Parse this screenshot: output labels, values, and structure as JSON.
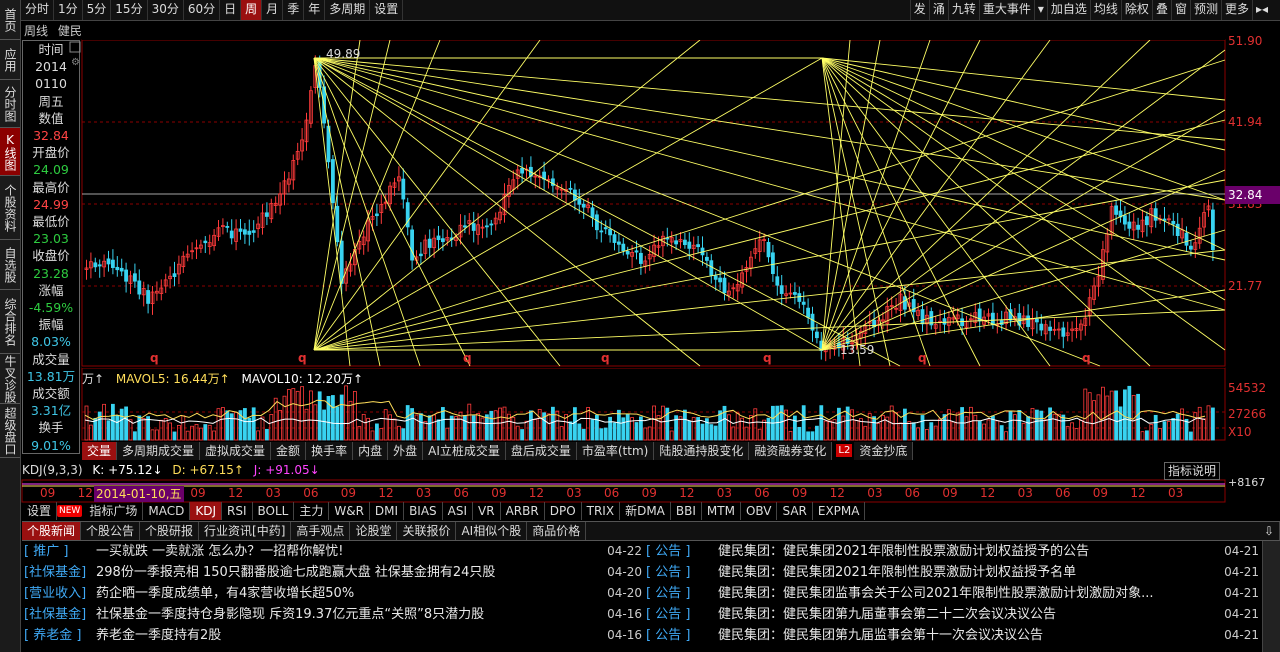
{
  "leftnav": [
    "首页",
    "应用",
    "分时图",
    "K线图",
    "个股资料",
    "自选股",
    "综合排名",
    "牛叉诊股",
    "超级盘口"
  ],
  "toolbar": {
    "periods": [
      "分时",
      "1分",
      "5分",
      "15分",
      "30分",
      "60分",
      "日",
      "周",
      "月",
      "季",
      "年",
      "多周期",
      "设置"
    ],
    "active": "周",
    "right": [
      "发",
      "涌",
      "九转",
      "重大事件",
      "▾",
      "加自选",
      "均线",
      "除权",
      "叠",
      "窗",
      "预测",
      "更多"
    ]
  },
  "subtitle": {
    "period": "周线",
    "stock": "健民集团"
  },
  "info": {
    "time_label": "时间",
    "year": "2014",
    "date": "0110",
    "weekday": "周五",
    "value_label": "数值",
    "value": "32.84",
    "open_label": "开盘价",
    "open": "24.09",
    "high_label": "最高价",
    "high": "24.99",
    "low_label": "最低价",
    "low": "23.03",
    "close_label": "收盘价",
    "close": "23.28",
    "chg_label": "涨幅",
    "chg": "-4.59%",
    "amp_label": "振幅",
    "amp": "8.03%",
    "vol_label": "成交量",
    "vol": "13.81万",
    "amt_label": "成交额",
    "amt": "3.31亿",
    "turn_label": "换手",
    "turn": "9.01%"
  },
  "price_axis": [
    "51.90",
    "41.94",
    "31.83",
    "21.77"
  ],
  "current_price": "32.84",
  "chart_labels": {
    "high": "49.89",
    "low": "13.59",
    "q": "q"
  },
  "vol": {
    "prefix": "万↑",
    "mavol5": "MAVOL5: 16.44万↑",
    "mavol10": "MAVOL10: 12.20万↑",
    "axis": [
      "54532",
      "27266",
      "X10"
    ]
  },
  "indtabs": [
    "交量",
    "多周期成交量",
    "虚拟成交量",
    "金额",
    "换手率",
    "内盘",
    "外盘",
    "AI立桩成交量",
    "盘后成交量",
    "市盈率(ttm)",
    "陆股通持股变化",
    "融资融券变化",
    "资金抄底"
  ],
  "indtabs_badge": "L2",
  "kdj": {
    "name": "KDJ(9,3,3)",
    "k": "K: +75.12↓",
    "d": "D: +67.15↑",
    "j": "J: +91.05↓",
    "button": "指标说明",
    "axis": "+8167"
  },
  "dateaxis": [
    "09",
    "12",
    "03",
    "06",
    "09",
    "12",
    "03",
    "06",
    "09",
    "12",
    "03",
    "06",
    "09",
    "12",
    "03",
    "06",
    "09",
    "12",
    "03",
    "06",
    "09",
    "12",
    "03",
    "06",
    "09",
    "12",
    "03",
    "06",
    "09",
    "12",
    "03"
  ],
  "dateflag": "2014-01-10,五",
  "bottabs": {
    "settings": "设置",
    "new": "NEW",
    "items": [
      "指标广场",
      "MACD",
      "KDJ",
      "RSI",
      "BOLL",
      "主力",
      "W&R",
      "DMI",
      "BIAS",
      "ASI",
      "VR",
      "ARBR",
      "DPO",
      "TRIX",
      "新DMA",
      "BBI",
      "MTM",
      "OBV",
      "SAR",
      "EXPMA"
    ],
    "active": "KDJ"
  },
  "newstabs": {
    "items": [
      "个股新闻",
      "个股公告",
      "个股研报",
      "行业资讯[中药]",
      "高手观点",
      "论股堂",
      "关联报价",
      "AI相似个股",
      "商品价格"
    ],
    "active": "个股新闻"
  },
  "news_left": [
    {
      "tag": "[ 推广 ]",
      "title": "一买就跌 一卖就涨 怎么办？一招帮你解忧!",
      "date": "04-22"
    },
    {
      "tag": "[社保基金]",
      "title": "298份一季报亮相 150只翻番股逾七成跑赢大盘 社保基金拥有24只股",
      "date": "04-20"
    },
    {
      "tag": "[营业收入]",
      "title": "药企晒一季度成绩单，有4家营收增长超50%",
      "date": "04-20"
    },
    {
      "tag": "[社保基金]",
      "title": "社保基金一季度持仓身影隐现 斥资19.37亿元重点“关照”8只潜力股",
      "date": "04-16"
    },
    {
      "tag": "[ 养老金 ]",
      "title": "养老金一季度持有2股",
      "date": "04-16"
    }
  ],
  "news_right": [
    {
      "tag": "[ 公告 ]",
      "title": "健民集团：健民集团2021年限制性股票激励计划权益授予的公告",
      "date": "04-21"
    },
    {
      "tag": "[ 公告 ]",
      "title": "健民集团：健民集团2021年限制性股票激励计划权益授予名单",
      "date": "04-21"
    },
    {
      "tag": "[ 公告 ]",
      "title": "健民集团：健民集团监事会关于公司2021年限制性股票激励计划激励对象...",
      "date": "04-21"
    },
    {
      "tag": "[ 公告 ]",
      "title": "健民集团：健民集团第九届董事会第二十二次会议决议公告",
      "date": "04-21"
    },
    {
      "tag": "[ 公告 ]",
      "title": "健民集团：健民集团第九届监事会第十一次会议决议公告",
      "date": "04-21"
    }
  ],
  "colors": {
    "up": "#ff3b3b",
    "down": "#38d3f0",
    "fan": "#ffff66",
    "accent": "#9a1010"
  }
}
